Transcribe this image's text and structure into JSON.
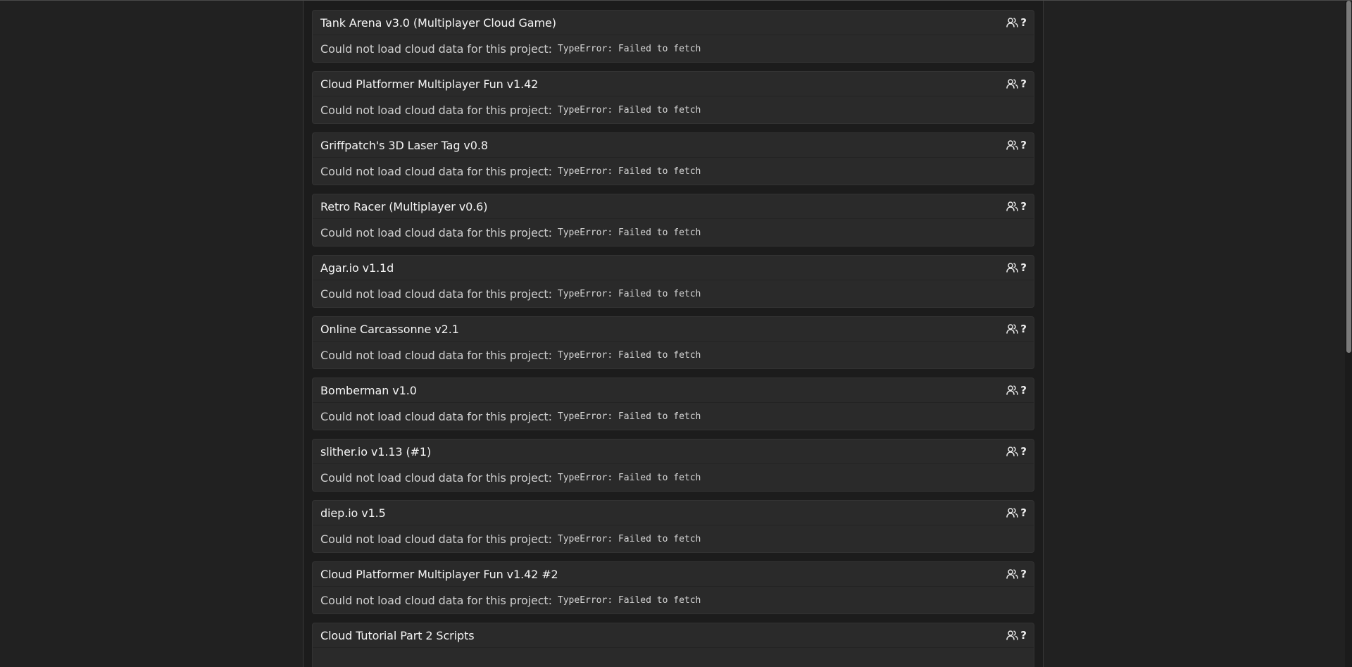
{
  "projects": [
    {
      "title": "Tank Arena v3.0 (Multiplayer Cloud Game)",
      "status": "Could not load cloud data for this project:",
      "error": "TypeError: Failed to fetch",
      "help": "?"
    },
    {
      "title": "Cloud Platformer Multiplayer Fun v1.42",
      "status": "Could not load cloud data for this project:",
      "error": "TypeError: Failed to fetch",
      "help": "?"
    },
    {
      "title": "Griffpatch's 3D Laser Tag v0.8",
      "status": "Could not load cloud data for this project:",
      "error": "TypeError: Failed to fetch",
      "help": "?"
    },
    {
      "title": "Retro Racer (Multiplayer v0.6)",
      "status": "Could not load cloud data for this project:",
      "error": "TypeError: Failed to fetch",
      "help": "?"
    },
    {
      "title": "Agar.io v1.1d",
      "status": "Could not load cloud data for this project:",
      "error": "TypeError: Failed to fetch",
      "help": "?"
    },
    {
      "title": "Online Carcassonne v2.1",
      "status": "Could not load cloud data for this project:",
      "error": "TypeError: Failed to fetch",
      "help": "?"
    },
    {
      "title": "Bomberman v1.0",
      "status": "Could not load cloud data for this project:",
      "error": "TypeError: Failed to fetch",
      "help": "?"
    },
    {
      "title": "slither.io v1.13 (#1)",
      "status": "Could not load cloud data for this project:",
      "error": "TypeError: Failed to fetch",
      "help": "?"
    },
    {
      "title": "diep.io v1.5",
      "status": "Could not load cloud data for this project:",
      "error": "TypeError: Failed to fetch",
      "help": "?"
    },
    {
      "title": "Cloud Platformer Multiplayer Fun v1.42 #2",
      "status": "Could not load cloud data for this project:",
      "error": "TypeError: Failed to fetch",
      "help": "?"
    },
    {
      "title": "Cloud Tutorial Part 2 Scripts",
      "status": "",
      "error": "",
      "help": "?"
    }
  ],
  "icons": {
    "player_count": "users-icon",
    "help": "question-icon"
  },
  "colors": {
    "background": "#212121",
    "column": "#1c1c1c",
    "card": "#2a2a2a",
    "text": "#f4f4f4"
  }
}
